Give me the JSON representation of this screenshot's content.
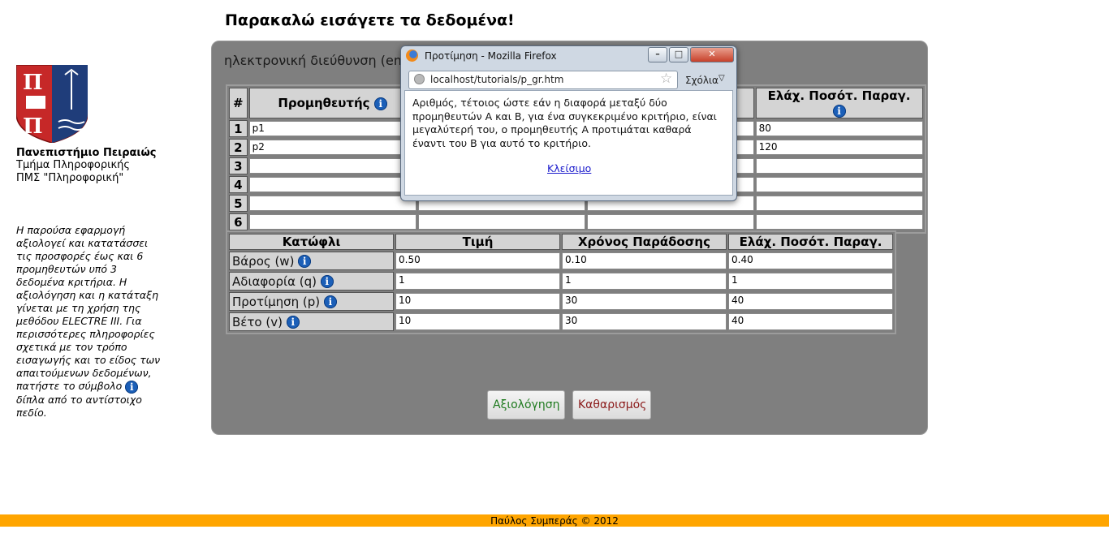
{
  "page_heading": "Παρακαλώ εισάγετε τα δεδομένα!",
  "sidebar": {
    "university": "Πανεπιστήμιο Πειραιώς",
    "department": "Τμήμα Πληροφορικής",
    "program": "ΠΜΣ \"Πληροφορική\"",
    "description_part1": "Η παρούσα εφαρμογή αξιολογεί και κατατάσσει τις προσφορές έως και 6 προμηθευτών υπό 3 δεδομένα κριτήρια. Η αξιολόγηση και η κατάταξη γίνεται με τη χρήση της μεθόδου ELECTRE III. Για περισσότερες πληροφορίες σχετικά με τον τρόπο εισαγωγής και το είδος των απαιτούμενων δεδομένων, πατήστε το σύμβολο",
    "description_part2": "δίπλα από το αντίστοιχο πεδίο."
  },
  "email_label": "ηλεκτρονική διεύθυνση (em",
  "suppliers_table": {
    "headers": [
      "#",
      "Προμηθευτής",
      "",
      "",
      "Ελάχ. Ποσότ. Παραγ."
    ],
    "rows": [
      {
        "num": "1",
        "supplier": "p1",
        "last": "80"
      },
      {
        "num": "2",
        "supplier": "p2",
        "last": "120"
      },
      {
        "num": "3",
        "supplier": "",
        "last": ""
      },
      {
        "num": "4",
        "supplier": "",
        "last": ""
      },
      {
        "num": "5",
        "supplier": "",
        "last": ""
      },
      {
        "num": "6",
        "supplier": "",
        "last": ""
      }
    ]
  },
  "thresholds_table": {
    "headers": [
      "Κατώφλι",
      "Τιμή",
      "Χρόνος Παράδοσης",
      "Ελάχ. Ποσότ. Παραγ."
    ],
    "rows": [
      {
        "label": "Βάρος (w)",
        "values": [
          "0.50",
          "0.10",
          "0.40"
        ]
      },
      {
        "label": "Αδιαφορία (q)",
        "values": [
          "1",
          "1",
          "1"
        ]
      },
      {
        "label": "Προτίμηση (p)",
        "values": [
          "10",
          "30",
          "40"
        ]
      },
      {
        "label": "Βέτο (v)",
        "values": [
          "10",
          "30",
          "40"
        ]
      }
    ]
  },
  "buttons": {
    "evaluate": "Αξιολόγηση",
    "clear": "Καθαρισμός"
  },
  "footer": "Παύλος Συμπεράς © 2012",
  "info_icon_glyph": "i",
  "popup": {
    "title": "Προτίμηση - Mozilla Firefox",
    "url": "localhost/tutorials/p_gr.htm",
    "menu_label": "Σχόλια",
    "text": "Αριθμός, τέτοιος ώστε εάν η διαφορά μεταξύ δύο προμηθευτών Α και Β, για ένα συγκεκριμένο κριτήριο, είναι μεγαλύτερή του, ο προμηθευτής Α προτιμάται καθαρά έναντι του Β για αυτό το κριτήριο.",
    "close_link": "Κλείσιμο"
  },
  "colors": {
    "panel": "#7f7f7f",
    "footer": "#ffa500",
    "info": "#1b5fb8",
    "evaluate": "#1e7a1e",
    "clear": "#8b1a1a"
  }
}
